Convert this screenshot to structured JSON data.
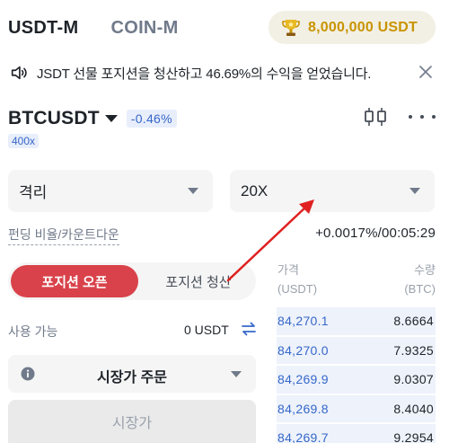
{
  "header": {
    "tabs": [
      {
        "label": "USDT-M",
        "active": true
      },
      {
        "label": "COIN-M",
        "active": false
      }
    ],
    "prize": {
      "icon": "trophy-icon",
      "label": "8,000,000 USDT",
      "color": "#c99400"
    }
  },
  "announcement": {
    "icon": "speaker-icon",
    "text": "JSDT 선물 포지션을 청산하고 46.69%의 수익을 얻었습니다.",
    "close_icon": "close-icon"
  },
  "symbol": {
    "name": "BTCUSDT",
    "change": "-0.46%",
    "leverage_badge": "400x",
    "chart_icon": "candlestick-chart-icon",
    "more_icon": "more-icon"
  },
  "selectors": {
    "margin_mode": "격리",
    "leverage": "20X"
  },
  "funding": {
    "label": "펀딩 비율/카운트다운",
    "value": "+0.0017%/00:05:29"
  },
  "position_tabs": [
    {
      "label": "포지션 오픈",
      "active": true
    },
    {
      "label": "포지션 청산",
      "active": false
    }
  ],
  "available": {
    "label": "사용 가능",
    "value": "0 USDT",
    "icon": "transfer-icon"
  },
  "order_type": {
    "info_icon": "info-icon",
    "label": "시장가 주문"
  },
  "market_price": {
    "label": "시장가"
  },
  "order_book": {
    "price_header": "가격",
    "price_unit": "(USDT)",
    "qty_header": "수량",
    "qty_unit": "(BTC)",
    "rows": [
      {
        "price": "84,270.1",
        "qty": "8.6664",
        "depth": 0.3
      },
      {
        "price": "84,270.0",
        "qty": "7.9325",
        "depth": 0.3
      },
      {
        "price": "84,269.9",
        "qty": "9.0307",
        "depth": 0.3
      },
      {
        "price": "84,269.8",
        "qty": "8.4040",
        "depth": 0.3
      },
      {
        "price": "84,269.7",
        "qty": "9.2954",
        "depth": 0.3
      }
    ]
  },
  "colors": {
    "accent_red": "#d9424a",
    "accent_blue": "#3667c9",
    "annotation_arrow": "#e02020"
  }
}
